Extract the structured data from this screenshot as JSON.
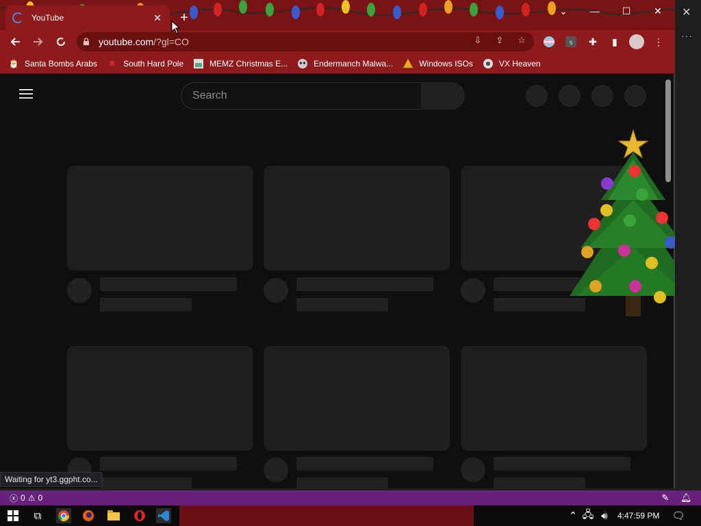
{
  "browser": {
    "tab": {
      "title": "YouTube",
      "close": "✕"
    },
    "new_tab": "+",
    "window_controls": {
      "chevron": "⌄",
      "minimize": "—",
      "maximize": "☐",
      "close": "✕"
    },
    "address": {
      "host": "youtube.com",
      "path": "/?gl=CO"
    },
    "bookmarks": [
      {
        "label": "Santa Bombs Arabs",
        "icon": "santa-figure-icon"
      },
      {
        "label": "South Hard Pole",
        "icon": "snowflake-icon"
      },
      {
        "label": "MEMZ Christmas E...",
        "icon": "image-icon"
      },
      {
        "label": "Endermanch Malwa...",
        "icon": "raccoon-icon"
      },
      {
        "label": "Windows ISOs",
        "icon": "folder-warning-icon"
      },
      {
        "label": "VX Heaven",
        "icon": "gear-skull-icon"
      }
    ],
    "status_text": "Waiting for yt3.ggpht.co..."
  },
  "youtube": {
    "search_placeholder": "Search"
  },
  "vscode": {
    "errors": "0",
    "warnings": "0",
    "close": "✕",
    "more": "···"
  },
  "taskbar": {
    "time": "4:47:59 PM"
  },
  "colors": {
    "chrome_theme": "#8e1b1b",
    "yt_bg": "#0f0f0f",
    "placeholder": "#1f1f1f",
    "vscode_status": "#68217a"
  }
}
